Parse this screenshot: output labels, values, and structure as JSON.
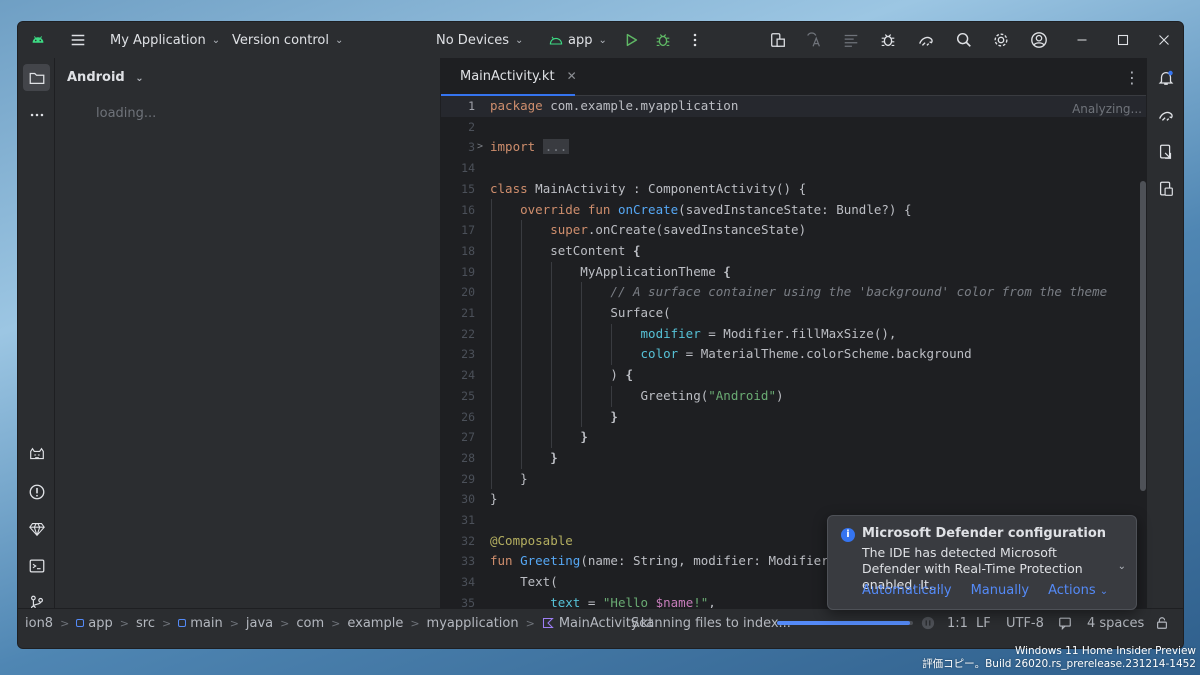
{
  "colors": {
    "accent": "#3574f0",
    "link": "#548af7",
    "android_green": "#3ddc84",
    "run_green": "#5fb865"
  },
  "titlebar": {
    "project": "My Application",
    "vcs": "Version control",
    "devices": "No Devices",
    "run_config": "app",
    "icons": [
      "android-logo-icon",
      "hamburger-menu-icon",
      "run-icon",
      "debug-icon",
      "more-vertical-icon",
      "device-manager-icon",
      "translate-icon",
      "profiler-icon",
      "bug-icon",
      "gradle-sync-icon",
      "search-icon",
      "gear-icon",
      "account-icon"
    ],
    "window_controls": [
      "minimize",
      "maximize",
      "close"
    ]
  },
  "project_panel": {
    "title": "Android",
    "loading": "loading..."
  },
  "editor": {
    "tab_label": "MainActivity.kt",
    "analyzing": "Analyzing...",
    "line_numbers": [
      "1",
      "2",
      "3",
      "14",
      "15",
      "16",
      "17",
      "18",
      "19",
      "20",
      "21",
      "22",
      "23",
      "24",
      "25",
      "26",
      "27",
      "28",
      "29",
      "30",
      "31",
      "32",
      "33",
      "34",
      "35"
    ]
  },
  "notification": {
    "title": "Microsoft Defender configuration",
    "body": "The IDE has detected Microsoft Defender with Real-Time Protection enabled. It...",
    "actions": [
      "Automatically",
      "Manually",
      "Actions"
    ]
  },
  "statusbar": {
    "breadcrumbs": [
      "ion8",
      "app",
      "src",
      "main",
      "java",
      "com",
      "example",
      "myapplication",
      "MainActivity.kt"
    ],
    "scanning": "Scanning files to index...",
    "progress": 0.98,
    "position": "1:1",
    "line_ending": "LF",
    "encoding": "UTF-8",
    "indent": "4 spaces"
  },
  "watermark": {
    "line1": "Windows 11 Home Insider Preview",
    "line2": "評価コピー。Build 26020.rs_prerelease.231214-1452"
  }
}
